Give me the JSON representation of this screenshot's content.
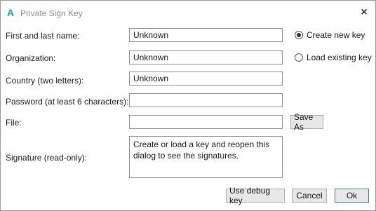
{
  "window": {
    "title": "Private Sign Key",
    "app_icon": "A"
  },
  "form": {
    "name_label": "First and last name:",
    "name_value": "Unknown",
    "org_label": "Organization:",
    "org_value": "Unknown",
    "country_label": "Country (two letters):",
    "country_value": "Unknown",
    "password_label": "Password (at least 6 characters):",
    "password_value": "",
    "file_label": "File:",
    "file_value": "",
    "save_as_label": "Save As",
    "signature_label": "Signature (read-only):",
    "signature_value": "Create or load a key and reopen this dialog to see the signatures."
  },
  "mode": {
    "options": [
      "Create new key",
      "Load existing key"
    ],
    "selected": "Create new key"
  },
  "buttons": {
    "debug_key": "Use debug key",
    "cancel": "Cancel",
    "ok": "Ok"
  },
  "icons": {
    "close": "×",
    "close_name": "close-icon",
    "app_name": "app-logo-icon"
  }
}
